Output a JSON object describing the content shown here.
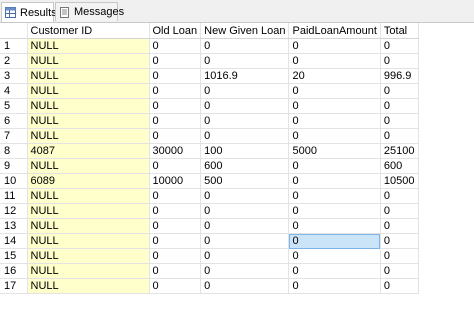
{
  "tabs": [
    {
      "label": "Results",
      "icon": "results-grid-icon",
      "active": true
    },
    {
      "label": "Messages",
      "icon": "messages-icon",
      "active": false
    }
  ],
  "grid": {
    "columns": [
      "",
      "Customer ID",
      "Old Loan",
      "New Given Loan",
      "PaidLoanAmount",
      "Total"
    ],
    "rows": [
      [
        "1",
        "NULL",
        "0",
        "0",
        "0",
        "0"
      ],
      [
        "2",
        "NULL",
        "0",
        "0",
        "0",
        "0"
      ],
      [
        "3",
        "NULL",
        "0",
        "1016.9",
        "20",
        "996.9"
      ],
      [
        "4",
        "NULL",
        "0",
        "0",
        "0",
        "0"
      ],
      [
        "5",
        "NULL",
        "0",
        "0",
        "0",
        "0"
      ],
      [
        "6",
        "NULL",
        "0",
        "0",
        "0",
        "0"
      ],
      [
        "7",
        "NULL",
        "0",
        "0",
        "0",
        "0"
      ],
      [
        "8",
        "4087",
        "30000",
        "100",
        "5000",
        "25100"
      ],
      [
        "9",
        "NULL",
        "0",
        "600",
        "0",
        "600"
      ],
      [
        "10",
        "6089",
        "10000",
        "500",
        "0",
        "10500"
      ],
      [
        "11",
        "NULL",
        "0",
        "0",
        "0",
        "0"
      ],
      [
        "12",
        "NULL",
        "0",
        "0",
        "0",
        "0"
      ],
      [
        "13",
        "NULL",
        "0",
        "0",
        "0",
        "0"
      ],
      [
        "14",
        "NULL",
        "0",
        "0",
        "0",
        "0"
      ],
      [
        "15",
        "NULL",
        "0",
        "0",
        "0",
        "0"
      ],
      [
        "16",
        "NULL",
        "0",
        "0",
        "0",
        "0"
      ],
      [
        "17",
        "NULL",
        "0",
        "0",
        "0",
        "0"
      ]
    ],
    "selected_cell": {
      "row": 13,
      "col": 4
    },
    "colors": {
      "null_cell_bg": "#ffffcc",
      "selected_bg": "#cce4f7",
      "gridline": "#e3e3e3"
    }
  }
}
